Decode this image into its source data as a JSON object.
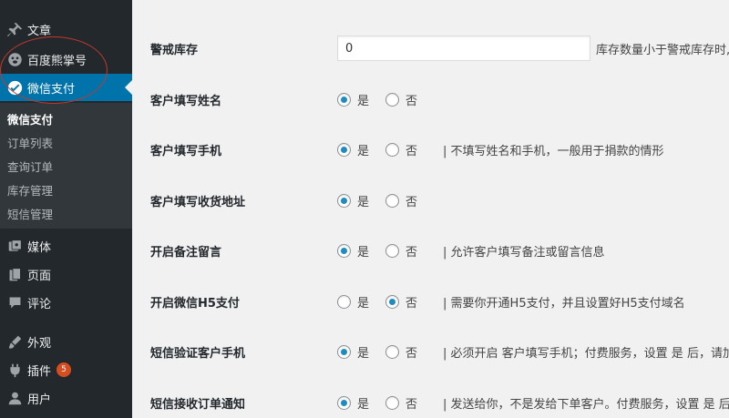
{
  "sidebar": {
    "items": [
      {
        "label": "文章",
        "icon": "pin-icon"
      },
      {
        "label": "百度熊掌号",
        "icon": "paw-icon"
      },
      {
        "label": "微信支付",
        "icon": "wechat-pay-icon",
        "active": true
      },
      {
        "label": "媒体",
        "icon": "media-icon"
      },
      {
        "label": "页面",
        "icon": "page-icon"
      },
      {
        "label": "评论",
        "icon": "comment-icon"
      },
      {
        "label": "外观",
        "icon": "brush-icon"
      },
      {
        "label": "插件",
        "icon": "plugin-icon",
        "badge": "5"
      },
      {
        "label": "用户",
        "icon": "user-icon"
      }
    ],
    "submenu": [
      "微信支付",
      "订单列表",
      "查询订单",
      "库存管理",
      "短信管理"
    ],
    "accent_color": "#0073aa",
    "annotation_color": "#c0392b"
  },
  "settings": {
    "stock_warning": {
      "label": "警戒库存",
      "value": "0",
      "description": "库存数量小于警戒库存时,"
    },
    "rows": [
      {
        "label": "客户填写姓名",
        "yes": "是",
        "no": "否",
        "selected": "yes",
        "description": ""
      },
      {
        "label": "客户填写手机",
        "yes": "是",
        "no": "否",
        "selected": "yes",
        "description": "| 不填写姓名和手机，一般用于捐款的情形"
      },
      {
        "label": "客户填写收货地址",
        "yes": "是",
        "no": "否",
        "selected": "yes",
        "description": ""
      },
      {
        "label": "开启备注留言",
        "yes": "是",
        "no": "否",
        "selected": "yes",
        "description": "| 允许客户填写备注或留言信息"
      },
      {
        "label": "开启微信H5支付",
        "yes": "是",
        "no": "否",
        "selected": "no",
        "description": "| 需要你开通H5支付，并且设置好H5支付域名"
      },
      {
        "label": "短信验证客户手机",
        "yes": "是",
        "no": "否",
        "selected": "yes",
        "description": "| 必须开启 客户填写手机；付费服务，设置 是 后，请加于"
      },
      {
        "label": "短信接收订单通知",
        "yes": "是",
        "no": "否",
        "selected": "yes",
        "description": "| 发送给你，不是发给下单客户。付费服务，设置 是 后，"
      }
    ]
  }
}
